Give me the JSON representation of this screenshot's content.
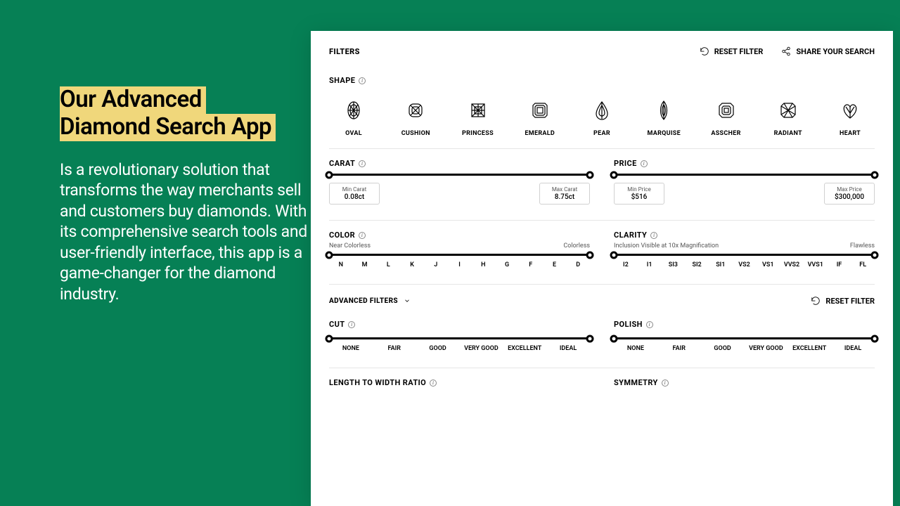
{
  "hero": {
    "title_l1": "Our Advanced",
    "title_l2": "Diamond Search App",
    "body": "Is a revolutionary solution that transforms the way merchants sell and customers buy diamonds. With its comprehensive search tools and user-friendly interface, this app is a game-changer for the diamond industry."
  },
  "topbar": {
    "filters": "FILTERS",
    "reset": "RESET FILTER",
    "share": "SHARE YOUR SEARCH"
  },
  "shape": {
    "label": "SHAPE",
    "items": [
      "OVAL",
      "CUSHION",
      "PRINCESS",
      "EMERALD",
      "PEAR",
      "MARQUISE",
      "ASSCHER",
      "RADIANT",
      "HEART"
    ]
  },
  "carat": {
    "label": "CARAT",
    "min_lbl": "Min Carat",
    "min_val": "0.08ct",
    "max_lbl": "Max Carat",
    "max_val": "8.75ct"
  },
  "price": {
    "label": "PRICE",
    "min_lbl": "Min Price",
    "min_val": "$516",
    "max_lbl": "Max Price",
    "max_val": "$300,000"
  },
  "color": {
    "label": "COLOR",
    "left_hint": "Near Colorless",
    "right_hint": "Colorless",
    "ticks": [
      "N",
      "M",
      "L",
      "K",
      "J",
      "I",
      "H",
      "G",
      "F",
      "E",
      "D"
    ]
  },
  "clarity": {
    "label": "CLARITY",
    "left_hint": "Inclusion Visible at 10x Magnification",
    "right_hint": "Flawless",
    "ticks": [
      "I2",
      "I1",
      "SI3",
      "SI2",
      "SI1",
      "VS2",
      "VS1",
      "VVS2",
      "VVS1",
      "IF",
      "FL"
    ]
  },
  "advanced": {
    "label": "ADVANCED FILTERS",
    "reset": "RESET FILTER"
  },
  "cut": {
    "label": "CUT"
  },
  "polish": {
    "label": "POLISH"
  },
  "quality_ticks": [
    "NONE",
    "FAIR",
    "GOOD",
    "VERY GOOD",
    "EXCELLENT",
    "IDEAL"
  ],
  "lwr": {
    "label": "LENGTH TO WIDTH RATIO"
  },
  "symmetry": {
    "label": "SYMMETRY"
  }
}
